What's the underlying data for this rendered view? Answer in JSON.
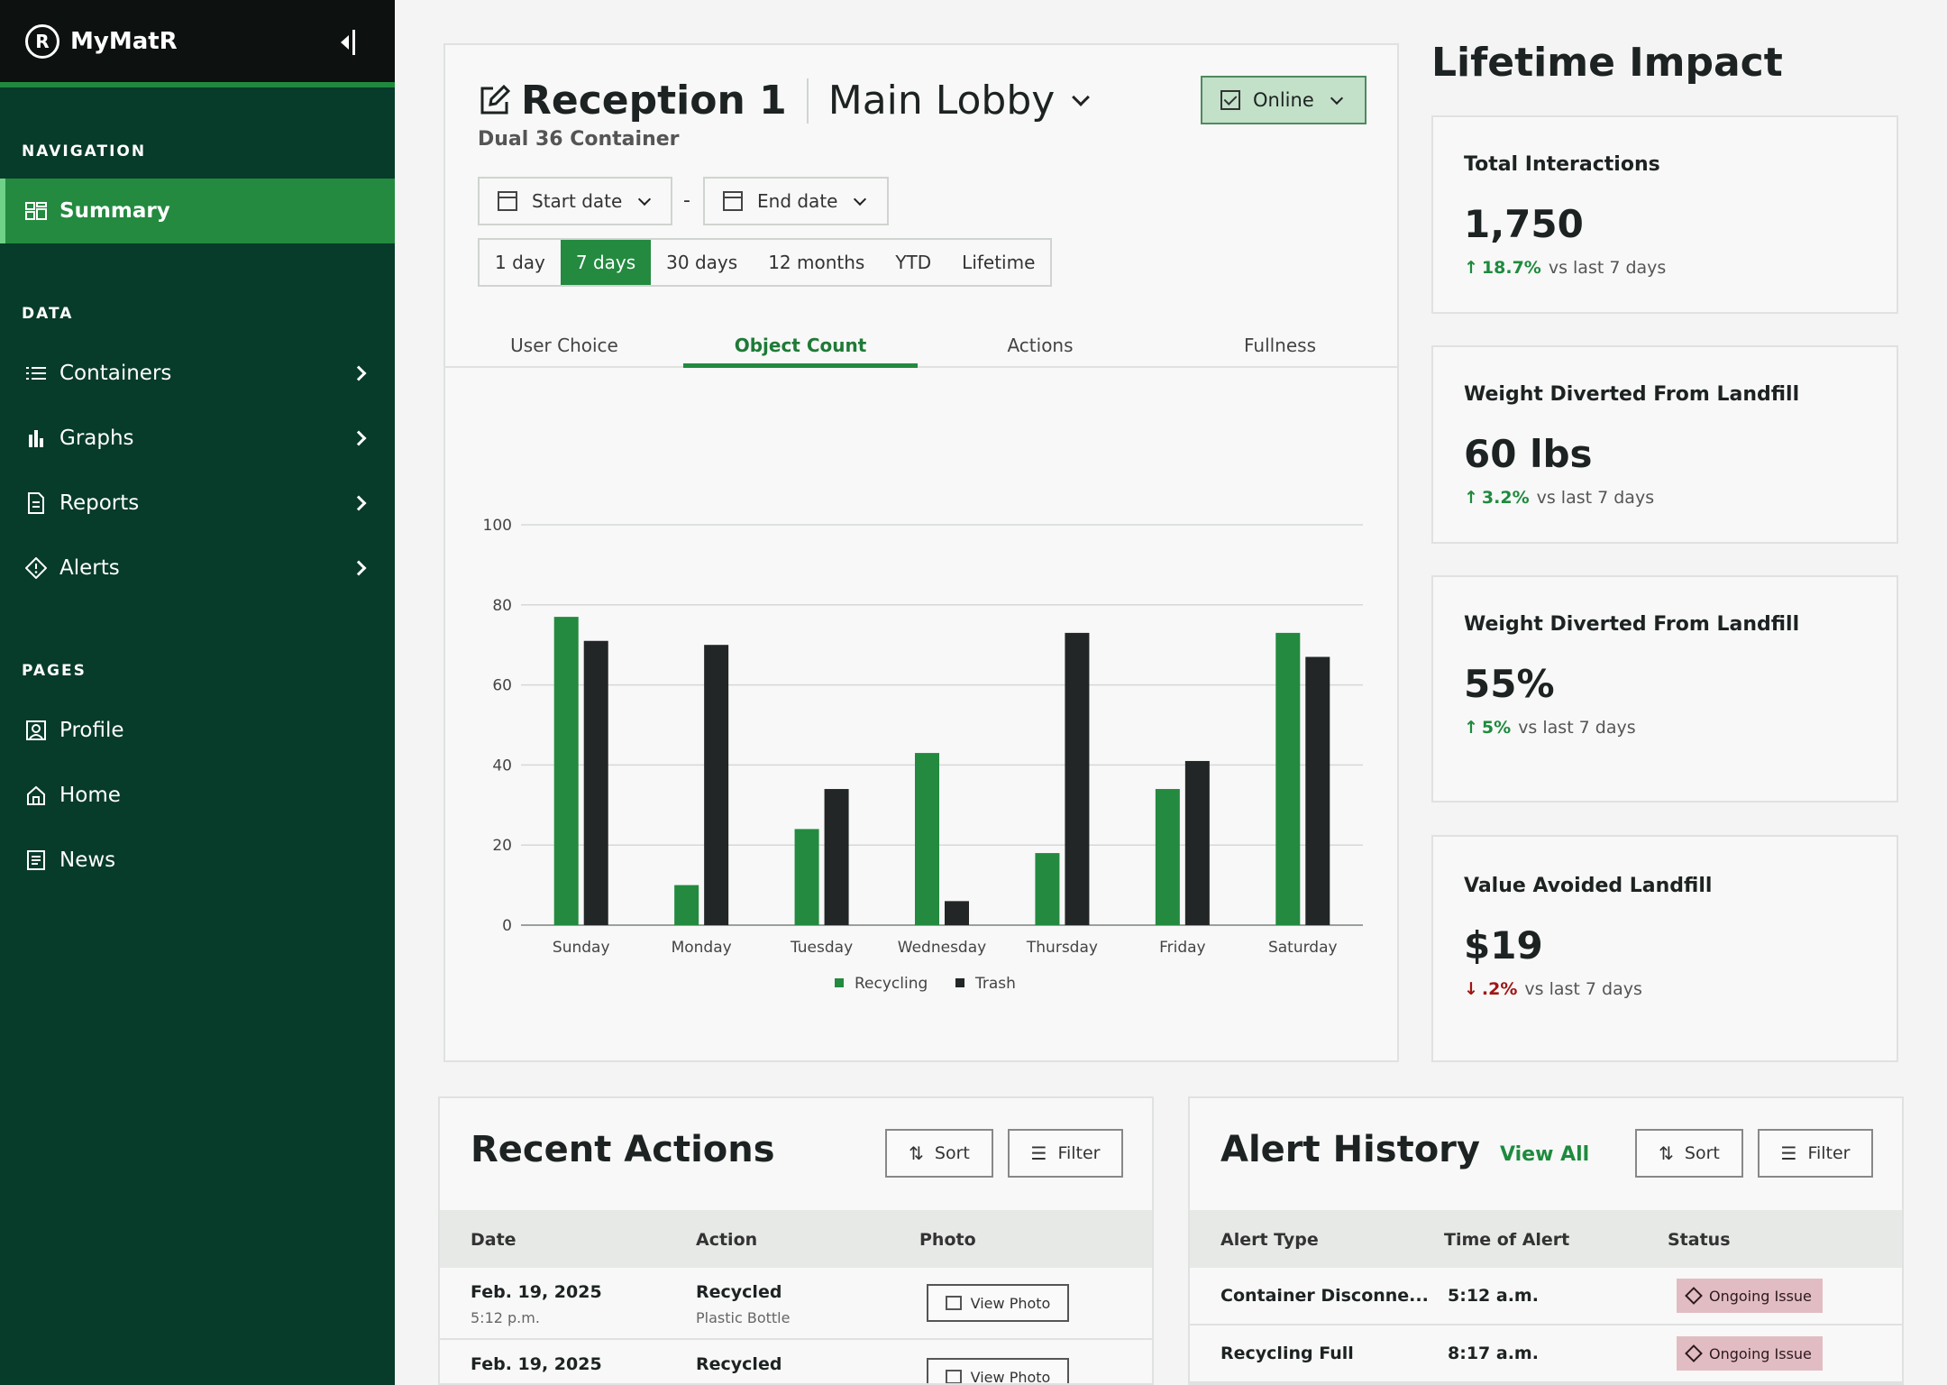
{
  "app": {
    "name": "MyMatR",
    "logo_letter": "R"
  },
  "sidebar": {
    "sections": [
      {
        "label": "NAVIGATION"
      },
      {
        "label": "DATA"
      },
      {
        "label": "PAGES"
      }
    ],
    "items": [
      {
        "label": "Summary",
        "icon": "dashboard-icon",
        "active": true
      },
      {
        "label": "Containers",
        "icon": "list-icon"
      },
      {
        "label": "Graphs",
        "icon": "bar-chart-icon"
      },
      {
        "label": "Reports",
        "icon": "document-icon"
      },
      {
        "label": "Alerts",
        "icon": "diamond-alert-icon"
      },
      {
        "label": "Profile",
        "icon": "profile-icon"
      },
      {
        "label": "Home",
        "icon": "home-icon"
      },
      {
        "label": "News",
        "icon": "news-icon"
      }
    ]
  },
  "header": {
    "title": "Reception 1",
    "location": "Main Lobby",
    "subtitle": "Dual 36 Container",
    "status": "Online"
  },
  "filters": {
    "start_date": "Start date",
    "end_date": "End date",
    "separator": "-",
    "ranges": [
      "1 day",
      "7 days",
      "30 days",
      "12 months",
      "YTD",
      "Lifetime"
    ],
    "active_range": "7 days"
  },
  "tabs": [
    "User Choice",
    "Object Count",
    "Actions",
    "Fullness"
  ],
  "active_tab": "Object Count",
  "chart_data": {
    "type": "bar",
    "categories": [
      "Sunday",
      "Monday",
      "Tuesday",
      "Wednesday",
      "Thursday",
      "Friday",
      "Saturday"
    ],
    "series": [
      {
        "name": "Recycling",
        "color": "#238a3f",
        "values": [
          77,
          10,
          24,
          43,
          18,
          34,
          73
        ]
      },
      {
        "name": "Trash",
        "color": "#222626",
        "values": [
          71,
          70,
          34,
          6,
          73,
          41,
          67
        ]
      }
    ],
    "ylim": [
      0,
      100
    ],
    "yticks": [
      0,
      20,
      40,
      60,
      80,
      100
    ],
    "grid": true,
    "legend": "bottom"
  },
  "impact": {
    "title": "Lifetime Impact",
    "cards": [
      {
        "label": "Total Interactions",
        "value": "1,750",
        "delta": "18.7%",
        "direction": "up",
        "compare": "vs last 7 days"
      },
      {
        "label": "Weight Diverted From Landfill",
        "value": "60 lbs",
        "delta": "3.2%",
        "direction": "up",
        "compare": "vs last 7 days"
      },
      {
        "label": "Weight Diverted From Landfill",
        "value": "55%",
        "delta": "5%",
        "direction": "up",
        "compare": "vs last 7 days"
      },
      {
        "label": "Value Avoided Landfill",
        "value": "$19",
        "delta": ".2%",
        "direction": "down",
        "compare": "vs last 7 days"
      }
    ]
  },
  "recent_actions": {
    "title": "Recent Actions",
    "sort_label": "Sort",
    "filter_label": "Filter",
    "columns": [
      "Date",
      "Action",
      "Photo"
    ],
    "rows": [
      {
        "date": "Feb. 19, 2025",
        "time": "5:12 p.m.",
        "action": "Recycled",
        "item": "Plastic Bottle",
        "photo": "View Photo"
      },
      {
        "date": "Feb. 19, 2025",
        "time": "",
        "action": "Recycled",
        "item": "",
        "photo": "View Photo"
      }
    ]
  },
  "alert_history": {
    "title": "Alert History",
    "view_all": "View All",
    "sort_label": "Sort",
    "filter_label": "Filter",
    "columns": [
      "Alert Type",
      "Time of Alert",
      "Status"
    ],
    "rows": [
      {
        "type": "Container Disconne...",
        "time": "5:12 a.m.",
        "status": "Ongoing Issue"
      },
      {
        "type": "Recycling Full",
        "time": "8:17 a.m.",
        "status": "Ongoing Issue"
      }
    ]
  }
}
